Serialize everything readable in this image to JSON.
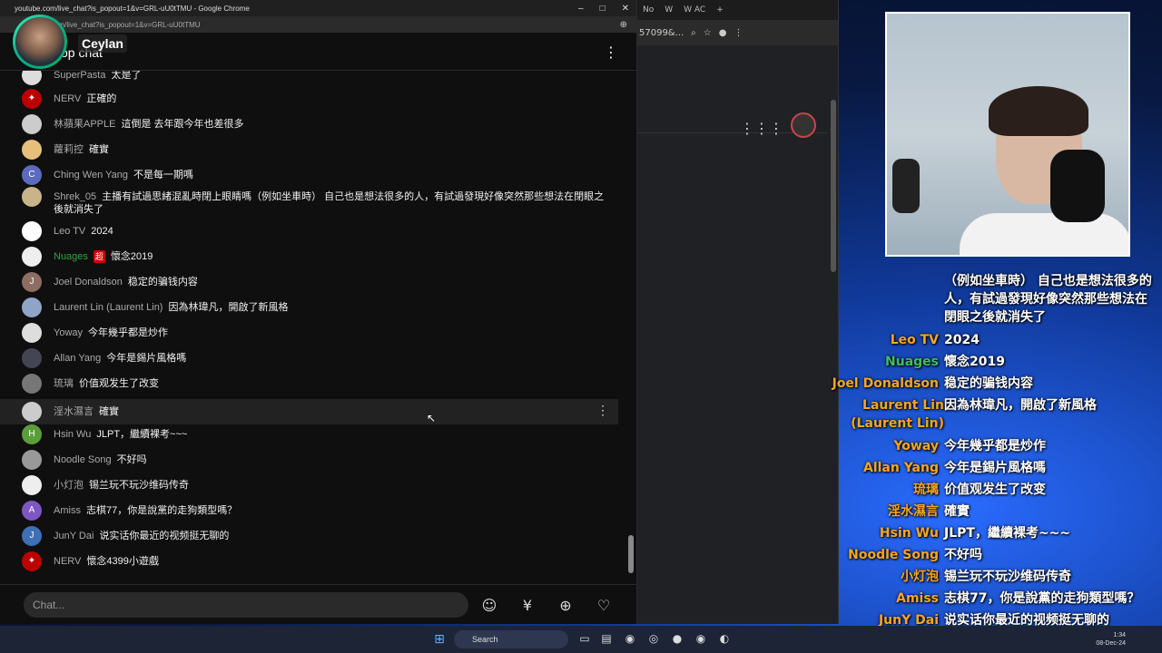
{
  "window_title": "youtube.com/live_chat?is_popout=1&v=GRL-uU0tTMU - Google Chrome",
  "url": "om/live_chat?is_popout=1&v=GRL-uU0tTMU",
  "chat_header": "Top chat",
  "streamer_name": "Ceylan",
  "chat_input_placeholder": "Chat...",
  "messages": [
    {
      "name": "SuperPasta",
      "text": "太是了",
      "av": "#ddd",
      "avtxt": ""
    },
    {
      "name": "NERV",
      "text": "正確的",
      "av": "#b00",
      "avtxt": "✦"
    },
    {
      "name": "林蘋果APPLE",
      "text": "這倒是 去年跟今年也差很多",
      "av": "#ccc",
      "avtxt": ""
    },
    {
      "name": "蘿莉控",
      "text": "確實",
      "av": "#e6c07b",
      "avtxt": ""
    },
    {
      "name": "Ching Wen Yang",
      "text": "不是每一期嗎",
      "av": "#5c6bc0",
      "avtxt": "C"
    },
    {
      "name": "Shrek_05",
      "text": "主播有試過思緒混亂時閉上眼睛嗎（例如坐車時） 自己也是想法很多的人，有試過發現好像突然那些想法在閉眼之後就消失了",
      "av": "#c9b48a",
      "avtxt": ""
    },
    {
      "name": "Leo TV",
      "text": "2024",
      "av": "#fff",
      "avtxt": ""
    },
    {
      "name": "Nuages",
      "text": "懷念2019",
      "av": "#eee",
      "avtxt": "",
      "green": true,
      "badge": "超"
    },
    {
      "name": "Joel Donaldson",
      "text": "稳定的骗钱内容",
      "av": "#8d6e63",
      "avtxt": "J"
    },
    {
      "name": "Laurent Lin (Laurent Lin)",
      "text": "因為林瑋凡，開啟了新風格",
      "av": "#90a4c8",
      "avtxt": ""
    },
    {
      "name": "Yoway",
      "text": "今年幾乎都是炒作",
      "av": "#ddd",
      "avtxt": ""
    },
    {
      "name": "Allan Yang",
      "text": "今年是錫片風格嗎",
      "av": "#445",
      "avtxt": ""
    },
    {
      "name": "琉璃",
      "text": "价值观发生了改变",
      "av": "#777",
      "avtxt": ""
    },
    {
      "name": "淫水濕言",
      "text": "確實",
      "av": "#ccc",
      "avtxt": ""
    },
    {
      "name": "Hsin Wu",
      "text": "JLPT，繼續裸考~~~",
      "av": "#5a9e3a",
      "avtxt": "H"
    },
    {
      "name": "Noodle Song",
      "text": "不好吗",
      "av": "#999",
      "avtxt": ""
    },
    {
      "name": "小灯泡",
      "text": "锡兰玩不玩沙维码传奇",
      "av": "#eee",
      "avtxt": ""
    },
    {
      "name": "Amiss",
      "text": "志棋77，你是說黨的走狗類型嗎？",
      "av": "#7e57c2",
      "avtxt": "A"
    },
    {
      "name": "JunY Dai",
      "text": "说实话你最近的视频挺无聊的",
      "av": "#3f6fb5",
      "avtxt": "J"
    },
    {
      "name": "NERV",
      "text": "懷念4399小遊戲",
      "av": "#b00",
      "avtxt": "✦"
    }
  ],
  "overlay_cont": "（例如坐車時） 自己也是想法很多的人，有試過發現好像突然那些想法在閉眼之後就消失了",
  "overlay": [
    {
      "name": "Leo TV",
      "text": "2024",
      "color": "#f5a623"
    },
    {
      "name": "Nuages",
      "text": "懷念2019",
      "color": "#3fbf5f"
    },
    {
      "name": "Joel Donaldson",
      "text": "稳定的骗钱内容",
      "color": "#f5a623"
    },
    {
      "name": "Laurent Lin (Laurent Lin)",
      "text": "因為林瑋凡，開啟了新風格",
      "color": "#f5a623"
    },
    {
      "name": "Yoway",
      "text": "今年幾乎都是炒作",
      "color": "#f5a623"
    },
    {
      "name": "Allan Yang",
      "text": "今年是錫片風格嗎",
      "color": "#f5a623"
    },
    {
      "name": "琉璃",
      "text": "价值观发生了改变",
      "color": "#f5a623"
    },
    {
      "name": "淫水濕言",
      "text": "確實",
      "color": "#f5a623"
    },
    {
      "name": "Hsin Wu",
      "text": "JLPT，繼續裸考~~~",
      "color": "#f5a623"
    },
    {
      "name": "Noodle Song",
      "text": "不好吗",
      "color": "#f5a623"
    },
    {
      "name": "小灯泡",
      "text": "锡兰玩不玩沙维码传奇",
      "color": "#f5a623"
    },
    {
      "name": "Amiss",
      "text": "志棋77，你是說黨的走狗類型嗎？",
      "color": "#f5a623"
    },
    {
      "name": "JunY Dai",
      "text": "说实话你最近的视频挺无聊的",
      "color": "#f5a623"
    },
    {
      "name": "NERV",
      "text": "懷念4399小遊戲",
      "color": "#f5a623"
    }
  ],
  "taskbar": {
    "search": "Search",
    "time": "1:34",
    "date": "08-Dec-24"
  },
  "win2": {
    "tab1": "No",
    "tab2": "W",
    "tab3": "W AC",
    "addr": "57099&..."
  }
}
